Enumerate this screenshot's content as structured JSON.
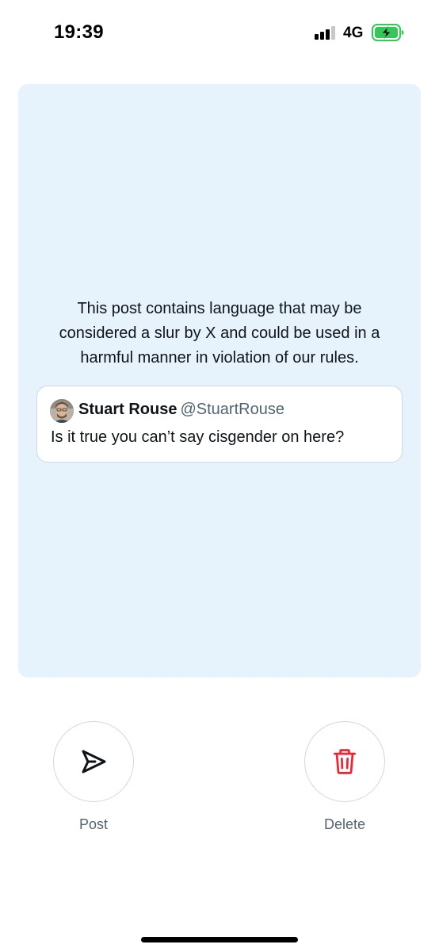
{
  "status_bar": {
    "time": "19:39",
    "network": "4G",
    "signal_bars_active": 3,
    "signal_bars_total": 4,
    "battery_level": 0.85,
    "battery_charging": true,
    "battery_color": "#34c759"
  },
  "alert_card": {
    "background_color": "#e6f3fc",
    "message": "This post contains language that may be considered a slur by X and could be used in a harmful manner in violation of our rules.",
    "quoted_post": {
      "author_name": "Stuart Rouse",
      "author_handle": "@StuartRouse",
      "text": "Is it true you can’t say cisgender on here?"
    }
  },
  "actions": {
    "post": {
      "label": "Post",
      "icon": "send-icon",
      "icon_color": "#0f1419"
    },
    "delete": {
      "label": "Delete",
      "icon": "trash-icon",
      "icon_color": "#f4212e"
    }
  }
}
